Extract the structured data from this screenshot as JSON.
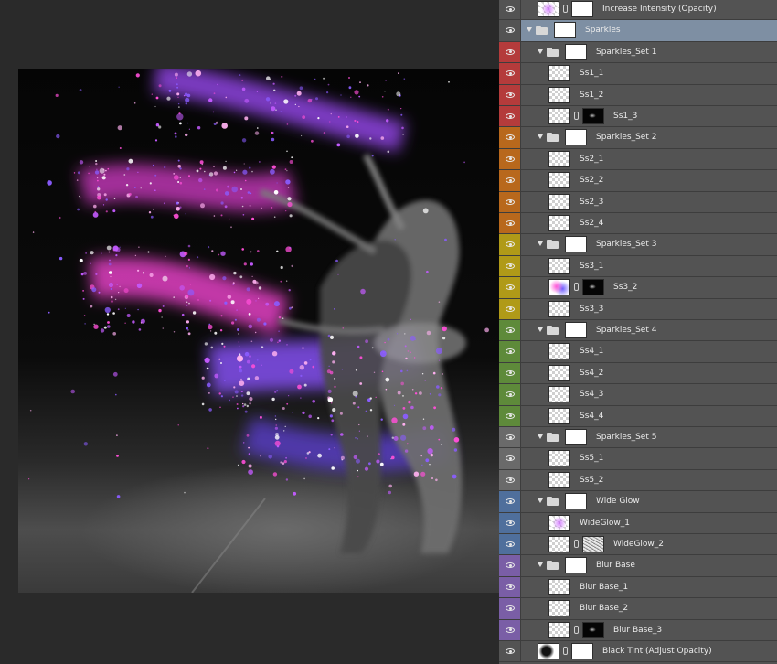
{
  "layers": [
    {
      "name": "Increase Intensity (Opacity)",
      "color": "#535353",
      "indent": 0,
      "type": "layer",
      "thumb": "pinkcheck",
      "mask": "white",
      "selected": false
    },
    {
      "name": "Sparkles",
      "color": "#535353",
      "indent": 0,
      "type": "group",
      "mask": "white",
      "selected": true
    },
    {
      "name": "Sparkles_Set 1",
      "color": "#b43b3b",
      "indent": 1,
      "type": "group",
      "mask": "white"
    },
    {
      "name": "Ss1_1",
      "color": "#b43b3b",
      "indent": 2,
      "type": "layer",
      "thumb": "checker"
    },
    {
      "name": "Ss1_2",
      "color": "#b43b3b",
      "indent": 2,
      "type": "layer",
      "thumb": "checker"
    },
    {
      "name": "Ss1_3",
      "color": "#b43b3b",
      "indent": 2,
      "type": "layer",
      "thumb": "checker",
      "mask": "black"
    },
    {
      "name": "Sparkles_Set 2",
      "color": "#b8681c",
      "indent": 1,
      "type": "group",
      "mask": "white"
    },
    {
      "name": "Ss2_1",
      "color": "#b8681c",
      "indent": 2,
      "type": "layer",
      "thumb": "checker"
    },
    {
      "name": "Ss2_2",
      "color": "#b8681c",
      "indent": 2,
      "type": "layer",
      "thumb": "checker"
    },
    {
      "name": "Ss2_3",
      "color": "#b8681c",
      "indent": 2,
      "type": "layer",
      "thumb": "checker"
    },
    {
      "name": "Ss2_4",
      "color": "#b8681c",
      "indent": 2,
      "type": "layer",
      "thumb": "checker"
    },
    {
      "name": "Sparkles_Set 3",
      "color": "#b09a18",
      "indent": 1,
      "type": "group",
      "mask": "white"
    },
    {
      "name": "Ss3_1",
      "color": "#b09a18",
      "indent": 2,
      "type": "layer",
      "thumb": "checker"
    },
    {
      "name": "Ss3_2",
      "color": "#b09a18",
      "indent": 2,
      "type": "layer",
      "thumb": "purple",
      "mask": "black"
    },
    {
      "name": "Ss3_3",
      "color": "#b09a18",
      "indent": 2,
      "type": "layer",
      "thumb": "checker"
    },
    {
      "name": "Sparkles_Set 4",
      "color": "#5e8a3a",
      "indent": 1,
      "type": "group",
      "mask": "white"
    },
    {
      "name": "Ss4_1",
      "color": "#5e8a3a",
      "indent": 2,
      "type": "layer",
      "thumb": "checker"
    },
    {
      "name": "Ss4_2",
      "color": "#5e8a3a",
      "indent": 2,
      "type": "layer",
      "thumb": "checker"
    },
    {
      "name": "Ss4_3",
      "color": "#5e8a3a",
      "indent": 2,
      "type": "layer",
      "thumb": "checker"
    },
    {
      "name": "Ss4_4",
      "color": "#5e8a3a",
      "indent": 2,
      "type": "layer",
      "thumb": "checker"
    },
    {
      "name": "Sparkles_Set 5",
      "color": "#6a6a6a",
      "indent": 1,
      "type": "group",
      "mask": "white"
    },
    {
      "name": "Ss5_1",
      "color": "#6a6a6a",
      "indent": 2,
      "type": "layer",
      "thumb": "checker"
    },
    {
      "name": "Ss5_2",
      "color": "#6a6a6a",
      "indent": 2,
      "type": "layer",
      "thumb": "checker"
    },
    {
      "name": "Wide Glow",
      "color": "#4f6f9c",
      "indent": 1,
      "type": "group",
      "mask": "white"
    },
    {
      "name": "WideGlow_1",
      "color": "#4f6f9c",
      "indent": 2,
      "type": "layer",
      "thumb": "pinkcheck"
    },
    {
      "name": "WideGlow_2",
      "color": "#4f6f9c",
      "indent": 2,
      "type": "layer",
      "thumb": "checker",
      "mask": "noise"
    },
    {
      "name": "Blur Base",
      "color": "#7a5ea6",
      "indent": 1,
      "type": "group",
      "mask": "white"
    },
    {
      "name": "Blur Base_1",
      "color": "#7a5ea6",
      "indent": 2,
      "type": "layer",
      "thumb": "checker"
    },
    {
      "name": "Blur Base_2",
      "color": "#7a5ea6",
      "indent": 2,
      "type": "layer",
      "thumb": "checker"
    },
    {
      "name": "Blur Base_3",
      "color": "#7a5ea6",
      "indent": 2,
      "type": "layer",
      "thumb": "checker",
      "mask": "black"
    },
    {
      "name": "Black Tint (Adjust Opacity)",
      "color": "#535353",
      "indent": 0,
      "type": "layer",
      "thumb": "bw",
      "mask": "white"
    }
  ],
  "artwork": {
    "sparkle_colors": [
      "#ff4fd8",
      "#c45bff",
      "#8a5cff",
      "#ffffff",
      "#ffb0f0"
    ]
  }
}
